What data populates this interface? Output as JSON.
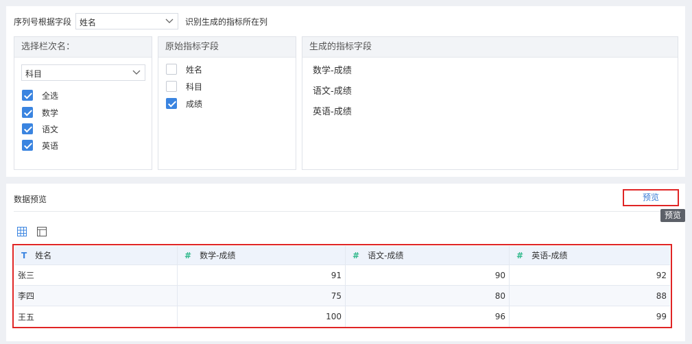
{
  "config": {
    "serial_label": "序列号根据字段",
    "serial_select_value": "姓名",
    "hint_text": "识别生成的指标所在列"
  },
  "column_box": {
    "title": "选择栏次名：",
    "select_value": "科目",
    "items": [
      {
        "label": "全选",
        "checked": true
      },
      {
        "label": "数学",
        "checked": true
      },
      {
        "label": "语文",
        "checked": true
      },
      {
        "label": "英语",
        "checked": true
      }
    ]
  },
  "source_box": {
    "title": "原始指标字段",
    "items": [
      {
        "label": "姓名",
        "checked": false
      },
      {
        "label": "科目",
        "checked": false
      },
      {
        "label": "成绩",
        "checked": true
      }
    ]
  },
  "generated_box": {
    "title": "生成的指标字段",
    "items": [
      "数学-成绩",
      "语文-成绩",
      "英语-成绩"
    ]
  },
  "preview_panel": {
    "title": "数据预览",
    "preview_button": "预览",
    "tooltip": "预览",
    "table": {
      "headers": [
        {
          "type_icon": "T",
          "label": "姓名"
        },
        {
          "type_icon": "#",
          "label": "数学-成绩"
        },
        {
          "type_icon": "#",
          "label": "语文-成绩"
        },
        {
          "type_icon": "#",
          "label": "英语-成绩"
        }
      ],
      "rows": [
        [
          "张三",
          "91",
          "90",
          "92"
        ],
        [
          "李四",
          "75",
          "80",
          "88"
        ],
        [
          "王五",
          "100",
          "96",
          "99"
        ]
      ]
    }
  },
  "colors": {
    "accent": "#3a84e0",
    "highlight_border": "#e02424",
    "numeric_type": "#2eb88a"
  }
}
